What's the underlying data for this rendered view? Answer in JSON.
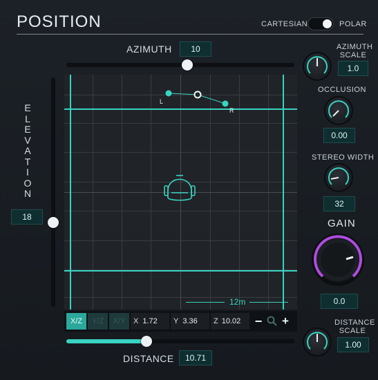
{
  "header": {
    "title": "POSITION",
    "mode_left": "CARTESIAN",
    "mode_right": "POLAR"
  },
  "azimuth": {
    "label": "AZIMUTH",
    "value": "10",
    "slider_fraction": 0.53
  },
  "elevation": {
    "label_letters": [
      "E",
      "L",
      "E",
      "V",
      "A",
      "T",
      "I",
      "O",
      "N"
    ],
    "value": "18",
    "slider_fraction": 0.38
  },
  "distance": {
    "label": "DISTANCE",
    "value": "10.71",
    "slider_fraction": 0.35
  },
  "pad": {
    "scale_label": "12m",
    "points": {
      "left": "L",
      "right": "R"
    }
  },
  "toolbar": {
    "views": [
      "X/Z",
      "Y/Z",
      "X/Y"
    ],
    "x_label": "X",
    "x_value": "1.72",
    "y_label": "Y",
    "y_value": "3.36",
    "z_label": "Z",
    "z_value": "10.02",
    "zoom_out": "−",
    "zoom_in": "+"
  },
  "right_panel": {
    "azimuth_scale": {
      "label_line1": "AZIMUTH",
      "label_line2": "SCALE",
      "value": "1.0"
    },
    "occlusion": {
      "label": "OCCLUSION",
      "value": "0.00"
    },
    "stereo_width": {
      "label": "STEREO WIDTH",
      "value": "32"
    },
    "gain": {
      "label": "GAIN",
      "value": "0.0"
    },
    "distance_scale": {
      "label_line1": "DISTANCE",
      "label_line2": "SCALE",
      "value": "1.00"
    }
  },
  "colors": {
    "accent": "#39d3c2",
    "gain_ring": "#b04be0",
    "value_box": "#0e2e30"
  }
}
